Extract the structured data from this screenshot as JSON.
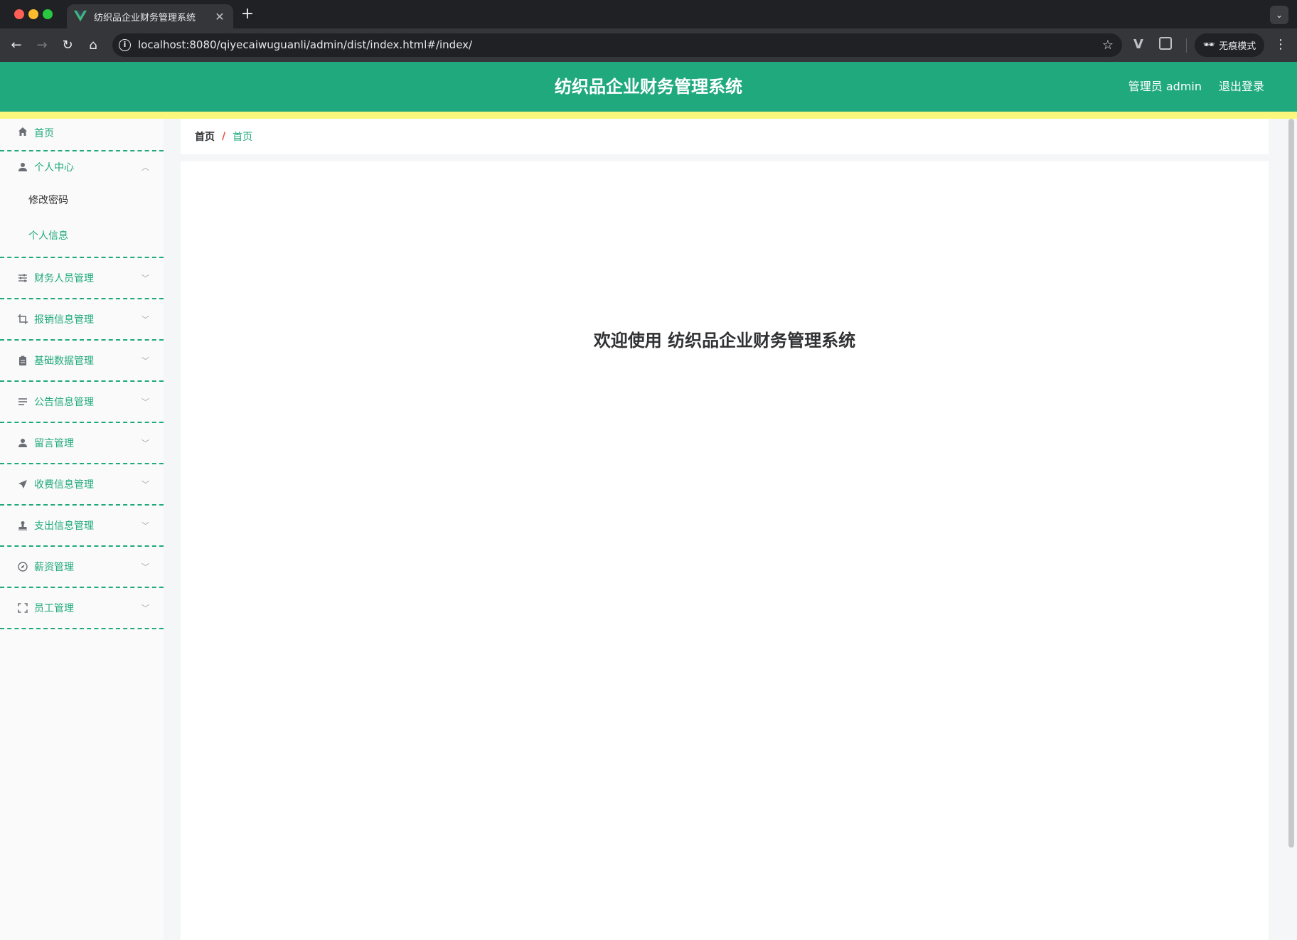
{
  "browser": {
    "tab_title": "纺织品企业财务管理系统",
    "url": "localhost:8080/qiyecaiwuguanli/admin/dist/index.html#/index/",
    "incognito_label": "无痕模式"
  },
  "header": {
    "title": "纺织品企业财务管理系统",
    "user_label": "管理员 admin",
    "logout_label": "退出登录"
  },
  "sidebar": {
    "home_label": "首页",
    "personal_center": {
      "label": "个人中心",
      "items": [
        "修改密码",
        "个人信息"
      ]
    },
    "items": [
      {
        "label": "财务人员管理",
        "icon": "sliders-icon"
      },
      {
        "label": "报销信息管理",
        "icon": "crop-icon"
      },
      {
        "label": "基础数据管理",
        "icon": "clipboard-icon"
      },
      {
        "label": "公告信息管理",
        "icon": "list-icon"
      },
      {
        "label": "留言管理",
        "icon": "user-icon"
      },
      {
        "label": "收费信息管理",
        "icon": "send-icon"
      },
      {
        "label": "支出信息管理",
        "icon": "stamp-icon"
      },
      {
        "label": "薪资管理",
        "icon": "compass-icon"
      },
      {
        "label": "员工管理",
        "icon": "fullscreen-icon"
      }
    ]
  },
  "breadcrumb": {
    "home": "首页",
    "separator": "/",
    "current": "首页"
  },
  "main": {
    "welcome": "欢迎使用 纺织品企业财务管理系统"
  },
  "colors": {
    "primary": "#1fa97c",
    "accent_bar": "#faf77c"
  }
}
